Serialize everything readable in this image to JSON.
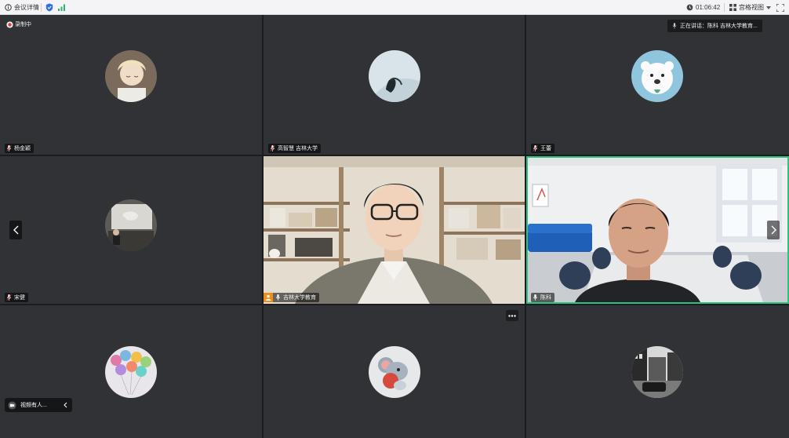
{
  "topbar": {
    "meeting_info": "会议详情",
    "timer": "01:06:42",
    "view_mode": "宫格视图"
  },
  "recording": {
    "label": "录制中"
  },
  "speaking": {
    "label": "正在讲话：",
    "name": "陈科 吉林大学教育..."
  },
  "participants": [
    {
      "name": "杨金颖"
    },
    {
      "name": "高智慧 吉林大学"
    },
    {
      "name": "王蕾"
    },
    {
      "name": "宋健"
    },
    {
      "name": "吉林大学教育"
    },
    {
      "name": "陈科"
    },
    {
      "name": ""
    },
    {
      "name": ""
    },
    {
      "name": ""
    }
  ],
  "floating_bar": {
    "label": "视频有人..."
  },
  "colors": {
    "tile_bg": "#303236",
    "active_border": "#2ec27e",
    "topbar_bg": "#f4f4f6",
    "accent_blue": "#2f6fe4"
  }
}
